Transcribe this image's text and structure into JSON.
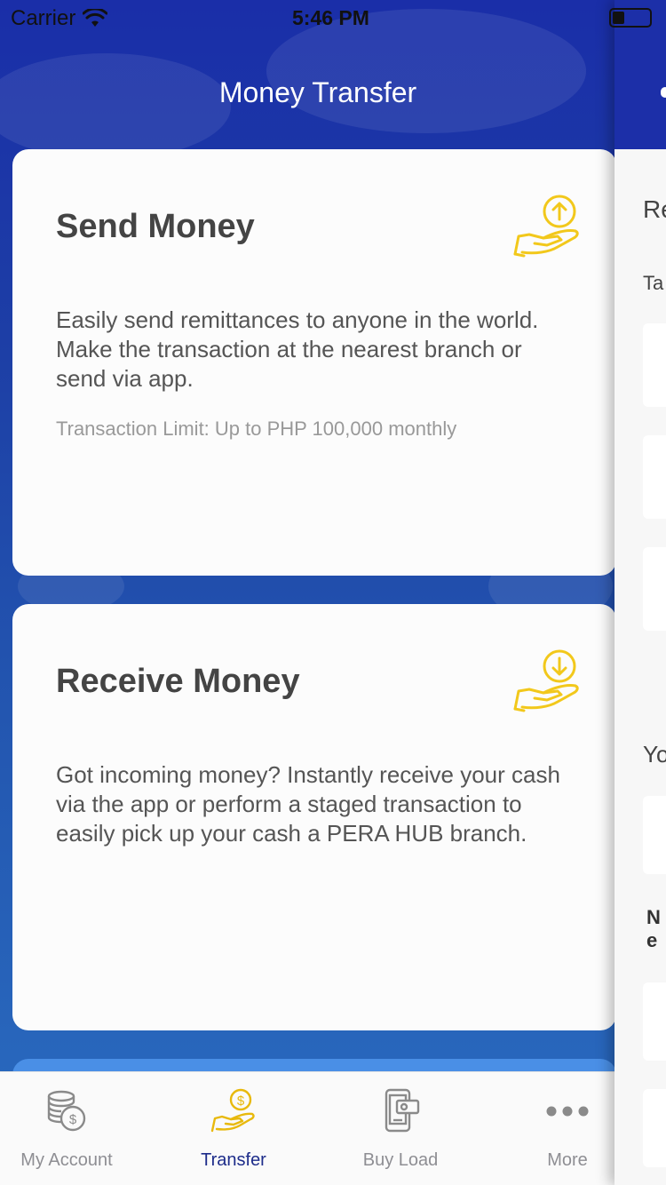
{
  "status_bar": {
    "carrier": "Carrier",
    "time": "5:46 PM"
  },
  "header": {
    "title": "Money Transfer"
  },
  "cards": {
    "send": {
      "title": "Send Money",
      "description": "Easily send remittances to anyone in the world. Make the transaction at the nearest branch or send via app.",
      "limit": "Transaction Limit: Up to PHP 100,000 monthly",
      "icon": "hand-coin-upload-icon"
    },
    "receive": {
      "title": "Receive Money",
      "description": "Got incoming money? Instantly receive your cash via the app or perform a staged transaction to easily pick up your cash a PERA HUB branch.",
      "icon": "hand-coin-download-icon"
    }
  },
  "tabs": [
    {
      "label": "My Account",
      "icon": "coins-stack-icon",
      "active": false
    },
    {
      "label": "Transfer",
      "icon": "hand-dollar-icon",
      "active": true
    },
    {
      "label": "Buy Load",
      "icon": "phone-load-icon",
      "active": false
    },
    {
      "label": "More",
      "icon": "more-dots-icon",
      "active": false
    }
  ],
  "peek_screen": {
    "heading": "Re",
    "label_1": "Ta",
    "label_2": "Yo",
    "note_line_1": "N",
    "note_line_2": "e"
  },
  "colors": {
    "header_blue": "#1a2ea8",
    "accent_yellow": "#f2c81b",
    "active_tab": "#1d2c8a",
    "inactive_tab": "#8e8e93"
  }
}
